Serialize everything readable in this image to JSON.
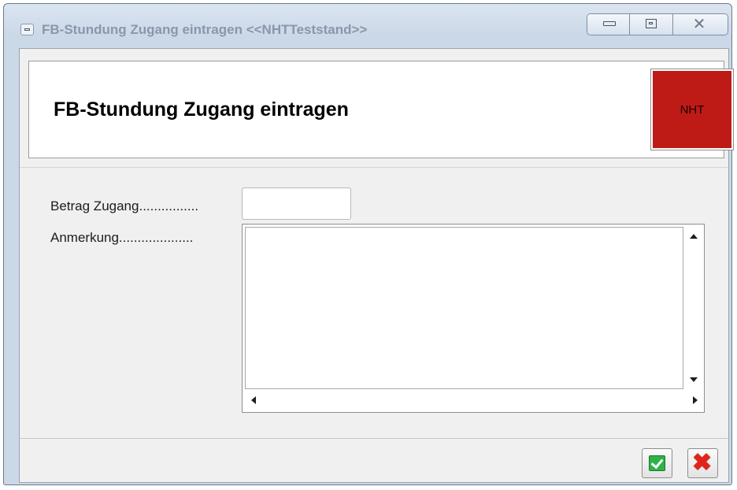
{
  "window": {
    "title": "FB-Stundung Zugang eintragen  <<NHTTeststand>>",
    "close_glyph": "✕",
    "sysmenu_icon": "window-system-menu-icon",
    "minimize_icon": "minimize-icon",
    "maximize_icon": "maximize-icon",
    "close_icon": "close-icon"
  },
  "header": {
    "title": "FB-Stundung Zugang eintragen",
    "logo_text": "NHT",
    "logo_color": "#bf1b16"
  },
  "form": {
    "betrag_label": "Betrag Zugang................",
    "betrag_value": "",
    "anmerkung_label": "Anmerkung....................",
    "anmerkung_value": ""
  },
  "footer": {
    "ok_icon": "green-check-icon",
    "cancel_icon": "red-x-icon",
    "cancel_glyph": "✖",
    "ok_color": "#2fb14a",
    "cancel_color": "#e1251b"
  }
}
